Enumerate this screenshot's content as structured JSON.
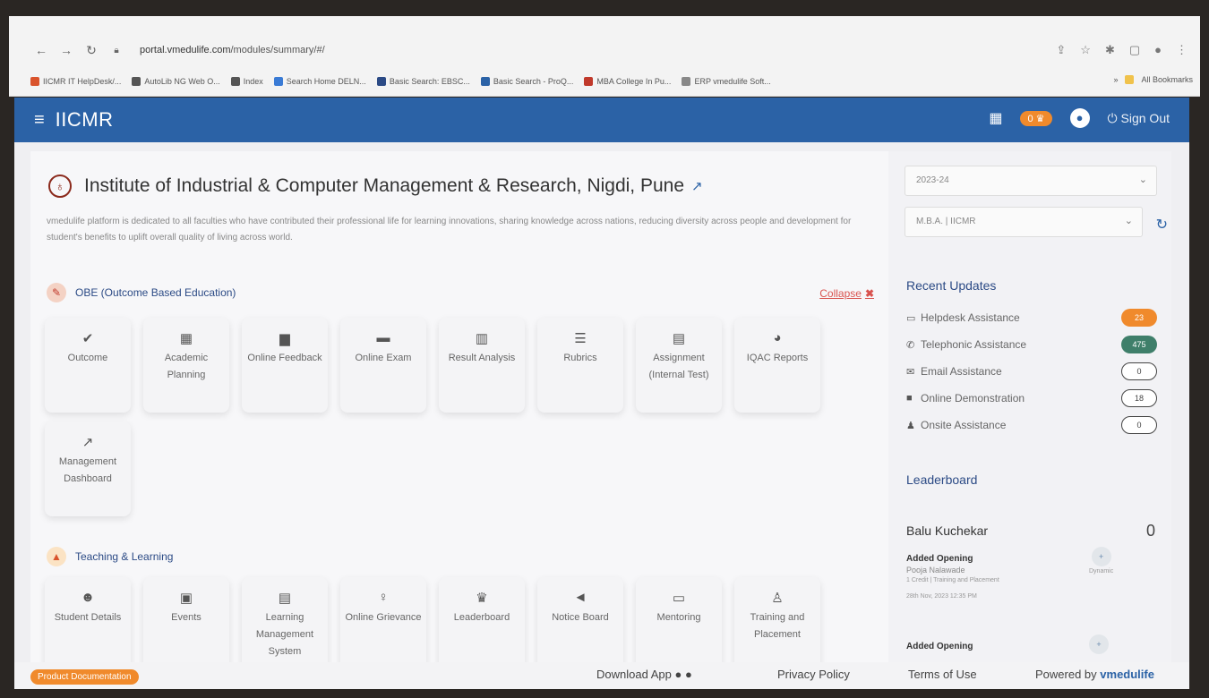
{
  "browser": {
    "url_host": "portal.vmedulife.com",
    "url_path": "/modules/summary/#/",
    "bookmarks": [
      {
        "label": "IICMR IT HelpDesk/...",
        "color": "#d9532c"
      },
      {
        "label": "AutoLib NG Web O...",
        "color": "#555555"
      },
      {
        "label": "Index",
        "color": "#555555"
      },
      {
        "label": "Search Home DELN...",
        "color": "#3a7bd5"
      },
      {
        "label": "Basic Search: EBSC...",
        "color": "#2b4a85"
      },
      {
        "label": "Basic Search - ProQ...",
        "color": "#2b62a6"
      },
      {
        "label": "MBA College In Pu...",
        "color": "#c0392b"
      },
      {
        "label": "ERP vmedulife Soft...",
        "color": "#888888"
      }
    ],
    "all_bookmarks_label": "All Bookmarks",
    "more_label": "»"
  },
  "header": {
    "brand": "IICMR",
    "trophy_count": "0",
    "sign_out": "Sign Out",
    "accent": "#2b62a6"
  },
  "institute": {
    "title": "Institute of Industrial & Computer Management & Research, Nigdi, Pune",
    "description": "vmedulife platform is dedicated to all faculties who have contributed their professional life for learning innovations, sharing knowledge across nations, reducing diversity across people and development for student's benefits to uplift overall quality of living across world."
  },
  "obe": {
    "title": "OBE (Outcome Based Education)",
    "collapse_label": "Collapse",
    "tiles": [
      {
        "icon": "✔",
        "label": "Outcome"
      },
      {
        "icon": "▦",
        "label": "Academic Planning"
      },
      {
        "icon": "▆",
        "label": "Online Feedback"
      },
      {
        "icon": "▬",
        "label": "Online Exam"
      },
      {
        "icon": "▥",
        "label": "Result Analysis"
      },
      {
        "icon": "☰",
        "label": "Rubrics"
      },
      {
        "icon": "▤",
        "label": "Assignment (Internal Test)"
      },
      {
        "icon": "◕",
        "label": "IQAC Reports"
      },
      {
        "icon": "↗",
        "label": "Management Dashboard"
      }
    ]
  },
  "teaching": {
    "title": "Teaching & Learning",
    "tiles": [
      {
        "icon": "☻",
        "label": "Student Details"
      },
      {
        "icon": "▣",
        "label": "Events"
      },
      {
        "icon": "▤",
        "label": "Learning Management System"
      },
      {
        "icon": "♀",
        "label": "Online Grievance"
      },
      {
        "icon": "♛",
        "label": "Leaderboard"
      },
      {
        "icon": "◄",
        "label": "Notice Board"
      },
      {
        "icon": "▭",
        "label": "Mentoring"
      },
      {
        "icon": "♙",
        "label": "Training and Placement"
      }
    ]
  },
  "sidebar": {
    "year_select": "2023-24",
    "program_select": "M.B.A. | IICMR",
    "recent_updates_title": "Recent Updates",
    "updates": [
      {
        "icon": "▭",
        "label": "Helpdesk Assistance",
        "count": "23",
        "style": "filled",
        "color": "#f08a2c"
      },
      {
        "icon": "✆",
        "label": "Telephonic Assistance",
        "count": "475",
        "style": "filled",
        "color": "#3f7f6a"
      },
      {
        "icon": "✉",
        "label": "Email Assistance",
        "count": "0",
        "style": "outline",
        "color": "#444444"
      },
      {
        "icon": "■",
        "label": "Online Demonstration",
        "count": "18",
        "style": "outline",
        "color": "#444444"
      },
      {
        "icon": "♟",
        "label": "Onsite Assistance",
        "count": "0",
        "style": "outline",
        "color": "#444444"
      }
    ],
    "leaderboard_title": "Leaderboard",
    "leader_name": "Balu Kuchekar",
    "leader_score": "0",
    "entries": [
      {
        "title": "Added Opening",
        "person": "Pooja Nalawade",
        "meta": "1 Credit | Training and Placement",
        "date": "28th Nov, 2023 12:35 PM",
        "tag": "Dynamic"
      },
      {
        "title": "Added Opening",
        "person": "",
        "meta": "",
        "date": "",
        "tag": ""
      }
    ]
  },
  "footer": {
    "doc_button": "Product Documentation",
    "download_app": "Download App",
    "privacy": "Privacy Policy",
    "terms": "Terms of Use",
    "powered_prefix": "Powered by",
    "powered_brand": "vmedulife"
  }
}
